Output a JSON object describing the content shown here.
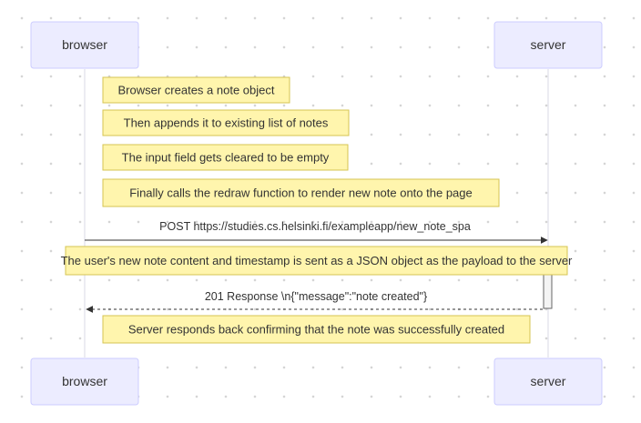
{
  "actors": {
    "browser": "browser",
    "server": "server"
  },
  "messages": {
    "post": "POST https://studies.cs.helsinki.fi/exampleapp/new_note_spa",
    "response": "201 Response \\n{\"message\":\"note created\"}"
  },
  "notes": {
    "create_object": "Browser creates a note object",
    "append": "Then appends it to existing list of notes",
    "clear_input": "The input field gets cleared to be empty",
    "redraw": "Finally calls the redraw function to render new note onto the page",
    "payload": "The user's new note content and timestamp is sent as a JSON object as the payload to the server",
    "confirm": "Server responds back confirming that the note was successfully created"
  },
  "colors": {
    "actor_fill": "#ececff",
    "actor_border": "#ccccff",
    "note_fill": "#fff5ad",
    "note_border": "#d6c452"
  }
}
